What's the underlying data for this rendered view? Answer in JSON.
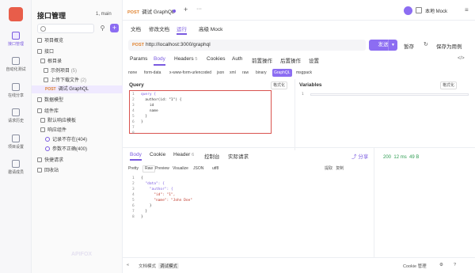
{
  "rail": {
    "items": [
      {
        "label": "接口管理"
      },
      {
        "label": "自动化测试"
      },
      {
        "label": "在线分享"
      },
      {
        "label": "请求历史"
      },
      {
        "label": "项目设置"
      },
      {
        "label": "邀请成员"
      }
    ]
  },
  "sidebar": {
    "title": "接口管理",
    "workspace": "1, main",
    "tree": [
      {
        "label": "项目概览"
      },
      {
        "label": "接口"
      },
      {
        "label": "根目录"
      },
      {
        "label": "示例项目",
        "count": "(5)"
      },
      {
        "label": "上传下载文件",
        "count": "(2)"
      },
      {
        "method": "POST",
        "label": "调试 GraphQL"
      },
      {
        "label": "数据模型"
      },
      {
        "label": "组件库"
      },
      {
        "label": "默认响应模板"
      },
      {
        "label": "响应组件"
      },
      {
        "label": "记录不存在(404)"
      },
      {
        "label": "参数不正确(400)"
      },
      {
        "label": "快捷请求"
      },
      {
        "label": "回收站"
      }
    ],
    "watermark": "APIFOX"
  },
  "tabbar": {
    "tab_method": "POST",
    "tab_title": "调试 GraphQL",
    "env": "本地 Mock"
  },
  "subtabs": [
    "文档",
    "修改文档",
    "运行",
    "高级 Mock"
  ],
  "request": {
    "method": "POST",
    "url": "http://localhost:3000/graphql",
    "send": "发送",
    "save": "暂存",
    "save_as": "保存为用例"
  },
  "req_tabs": [
    {
      "label": "Params"
    },
    {
      "label": "Body"
    },
    {
      "label": "Headers",
      "badge": "5"
    },
    {
      "label": "Cookies"
    },
    {
      "label": "Auth"
    },
    {
      "label": "前置操作"
    },
    {
      "label": "后置操作"
    },
    {
      "label": "设置"
    }
  ],
  "body_types": [
    "none",
    "form-data",
    "x-www-form-urlencoded",
    "json",
    "xml",
    "raw",
    "binary",
    "GraphQL",
    "msgpack"
  ],
  "query": {
    "header": "Query",
    "format": "格式化",
    "lines": [
      "1",
      "2",
      "3",
      "4",
      "5",
      "6",
      "7",
      "8"
    ],
    "code": [
      "query {",
      "  author(id: \"1\") {",
      "    id",
      "    name",
      "  }",
      "}",
      "",
      ""
    ]
  },
  "variables": {
    "header": "Variables",
    "format": "格式化",
    "lines": [
      "1"
    ]
  },
  "response": {
    "tabs": [
      {
        "label": "Body"
      },
      {
        "label": "Cookie"
      },
      {
        "label": "Header",
        "badge": "6"
      },
      {
        "label": "控制台"
      },
      {
        "label": "实际请求"
      }
    ],
    "share": "分享",
    "status": "200",
    "time": "12 ms",
    "size": "49 B",
    "view_modes": [
      "Pretty",
      "Raw",
      "Preview",
      "Visualize",
      "JSON",
      "utf8"
    ],
    "actions": {
      "extract": "提取",
      "copy": "复制"
    },
    "lines": [
      "1",
      "2",
      "3",
      "4",
      "5",
      "6",
      "7",
      "8"
    ],
    "code": [
      "{",
      "  \"data\": {",
      "    \"author\": {",
      "      \"id\": \"1\",",
      "      \"name\": \"John Doe\"",
      "    }",
      "  }",
      "}"
    ]
  },
  "bottom": {
    "doc_mode": "文档模式",
    "debug_mode": "调试模式",
    "cookie": "Cookie 管理"
  },
  "colors": {
    "accent": "#8c6df2",
    "post": "#e0822e",
    "highlight": "#d9534f"
  }
}
